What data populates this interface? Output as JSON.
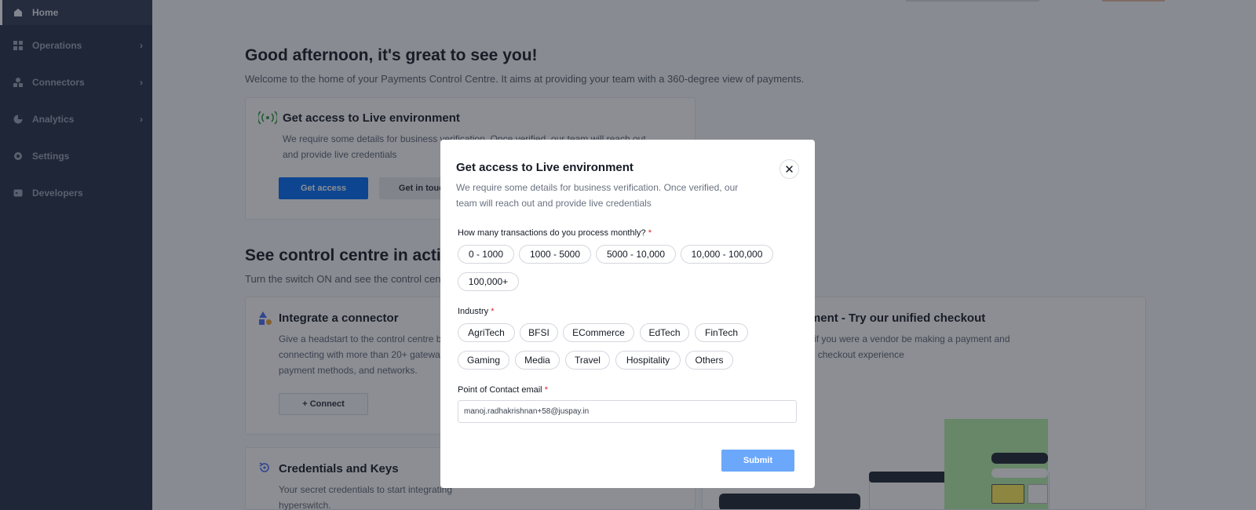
{
  "sidebar": {
    "items": [
      {
        "label": "Home",
        "icon": "home-icon",
        "active": true
      },
      {
        "label": "Operations",
        "icon": "operations-icon"
      },
      {
        "label": "Connectors",
        "icon": "connectors-icon"
      },
      {
        "label": "Analytics",
        "icon": "analytics-icon"
      },
      {
        "label": "Settings",
        "icon": "gear-icon"
      },
      {
        "label": "Developers",
        "icon": "developers-icon"
      }
    ]
  },
  "main": {
    "greeting": "Good afternoon, it's great to see you!",
    "welcome": "Welcome to the home of your Payments Control Centre. It aims at providing your team with a 360-degree view of payments.",
    "live_card": {
      "title": "Get access to Live environment",
      "text_line1": "We require some details for business verification. Once verified, our team will reach out",
      "text_line2": "and provide live credentials",
      "primary": "Get access",
      "secondary": "Get in touch"
    },
    "section_title": "See control centre in action",
    "section_sub": "Turn the switch ON and see the control centre in action",
    "connector_card": {
      "title": "Integrate a connector",
      "line1": "Give a headstart to the control centre by",
      "line2": "connecting with more than 20+ gateways,",
      "line3": "payment methods, and networks.",
      "button": "+ Connect"
    },
    "checkout_card": {
      "title": "Make a test payment - Try our unified checkout",
      "line1": "Test it out yourself as if you were a vendor be making a payment and",
      "line2": "experience the unified checkout experience"
    },
    "credentials_card": {
      "title": "Credentials and Keys",
      "line1": "Your secret credentials to start integrating",
      "line2": "hyperswitch."
    }
  },
  "modal": {
    "title": "Get access to Live environment",
    "desc_line1": "We require some details for business verification. Once verified, our",
    "desc_line2": "team will reach out and provide live credentials",
    "close_symbol": "✕",
    "transactions_label": "How many transactions do you process monthly?",
    "transactions_options": [
      "0 - 1000",
      "1000 - 5000",
      "5000 - 10,000",
      "10,000 - 100,000",
      "100,000+"
    ],
    "industry_label": "Industry",
    "industry_options": [
      "AgriTech",
      "BFSI",
      "ECommerce",
      "EdTech",
      "FinTech",
      "Gaming",
      "Media",
      "Travel",
      "Hospitality",
      "Others"
    ],
    "email_label": "Point of Contact email",
    "email_value": "manoj.radhakrishnan+58@juspay.in",
    "required_mark": "*",
    "submit": "Submit"
  },
  "colors": {
    "sidebar_bg": "#242f48",
    "primary": "#006df9",
    "submit_disabled": "#6ba8fb",
    "required": "#e0242d"
  }
}
